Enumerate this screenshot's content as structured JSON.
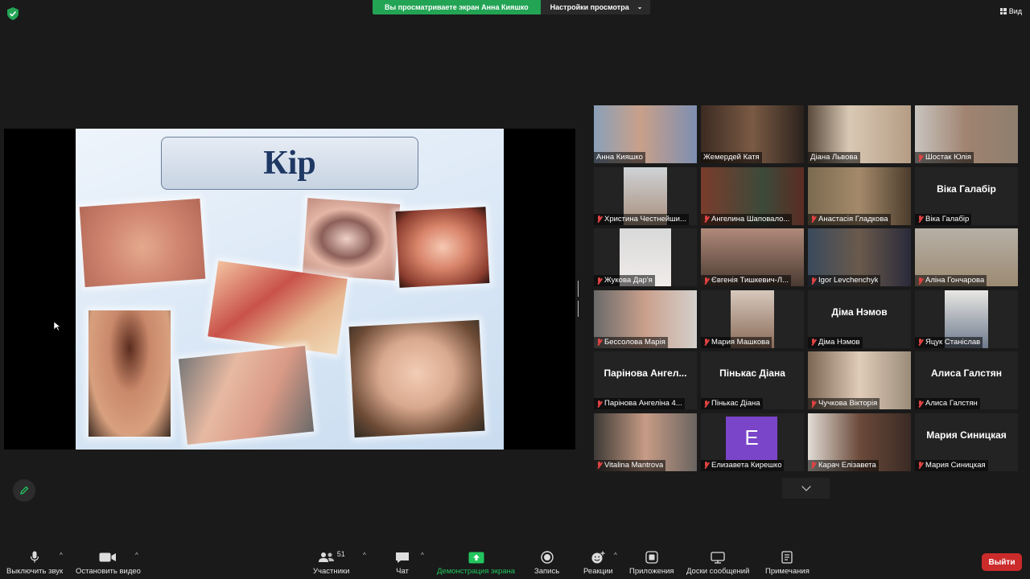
{
  "banner": {
    "viewing_text": "Вы просматриваете экран Анна Кияшко",
    "view_options_label": "Настройки просмотра"
  },
  "view_button_label": "Вид",
  "slide": {
    "title": "Кір"
  },
  "participants": [
    {
      "name": "Анна Кияшко",
      "muted": false,
      "video": true,
      "active": false
    },
    {
      "name": "Жемердей Катя",
      "muted": false,
      "video": true,
      "active": true
    },
    {
      "name": "Діана Львова",
      "muted": false,
      "video": true,
      "active": false
    },
    {
      "name": "Шостак Юлія",
      "muted": true,
      "video": true,
      "active": false
    },
    {
      "name": "Христина Честнейши...",
      "muted": true,
      "video": true,
      "active": false
    },
    {
      "name": "Ангелина Шаповало...",
      "muted": true,
      "video": true,
      "active": false
    },
    {
      "name": "Анастасія Гладкова",
      "muted": true,
      "video": true,
      "active": false
    },
    {
      "name": "Віка Галабір",
      "muted": true,
      "video": false,
      "big_name": "Віка Галабір",
      "active": false
    },
    {
      "name": "Жукова Дар'я",
      "muted": true,
      "video": true,
      "active": false
    },
    {
      "name": "Євгенія Тишкевич-Л...",
      "muted": true,
      "video": true,
      "active": false
    },
    {
      "name": "Igor Levchenchyk",
      "muted": true,
      "video": true,
      "active": false
    },
    {
      "name": "Аліна Гончарова",
      "muted": true,
      "video": true,
      "active": false
    },
    {
      "name": "Бессолова Марія",
      "muted": true,
      "video": true,
      "active": false
    },
    {
      "name": "Мария Машкова",
      "muted": true,
      "video": true,
      "active": false
    },
    {
      "name": "Діма Нэмов",
      "muted": true,
      "video": false,
      "big_name": "Діма Нэмов",
      "active": false
    },
    {
      "name": "Яцук Станіслав",
      "muted": true,
      "video": true,
      "active": false
    },
    {
      "name": "Парінова Ангеліна 4...",
      "muted": true,
      "video": false,
      "big_name": "Парінова Ангел...",
      "active": false
    },
    {
      "name": "Пінькас Діана",
      "muted": true,
      "video": false,
      "big_name": "Пінькас Діана",
      "active": false
    },
    {
      "name": "Чучкова Вікторія",
      "muted": true,
      "video": true,
      "active": false
    },
    {
      "name": "Алиса Галстян",
      "muted": true,
      "video": false,
      "big_name": "Алиса Галстян",
      "active": false
    },
    {
      "name": "Vitalina Mantrova",
      "muted": true,
      "video": true,
      "active": false
    },
    {
      "name": "Елизавета Кирешко",
      "muted": true,
      "video": false,
      "avatar_letter": "E",
      "active": false
    },
    {
      "name": "Карач Елізавета",
      "muted": true,
      "video": true,
      "active": false
    },
    {
      "name": "Мария Синицкая",
      "muted": true,
      "video": false,
      "big_name": "Мария Синицкая",
      "active": false
    }
  ],
  "toolbar": {
    "mute_label": "Выключить звук",
    "video_label": "Остановить видео",
    "participants_label": "Участники",
    "participants_count": "51",
    "chat_label": "Чат",
    "share_label": "Демонстрация экрана",
    "record_label": "Запись",
    "reactions_label": "Реакции",
    "apps_label": "Приложения",
    "whiteboards_label": "Доски сообщений",
    "notes_label": "Примечания",
    "leave_label": "Выйти"
  },
  "colors": {
    "accent_green": "#23a455",
    "leave_red": "#cc2b2b",
    "active_speaker": "#d8d565",
    "muted_red": "#e04343"
  }
}
